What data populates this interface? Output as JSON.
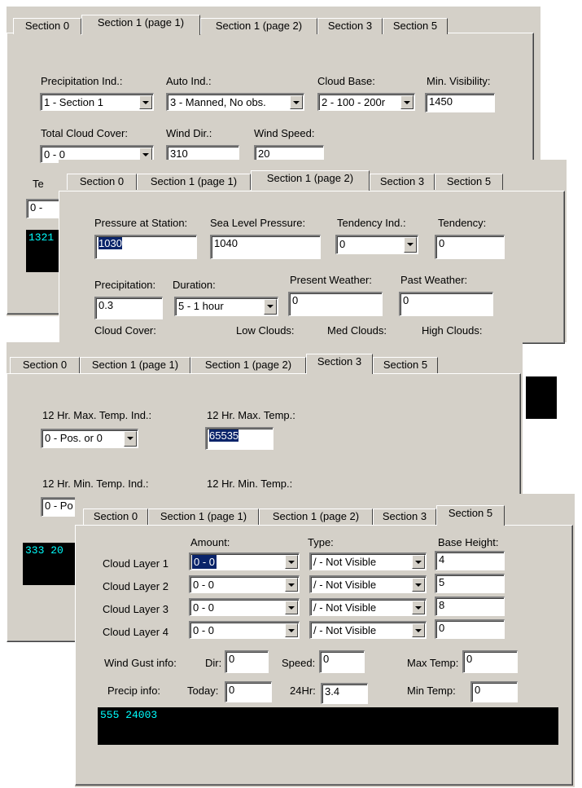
{
  "tabs": [
    "Section 0",
    "Section 1 (page 1)",
    "Section 1 (page 2)",
    "Section 3",
    "Section 5"
  ],
  "panel1": {
    "precip_ind_label": "Precipitation Ind.:",
    "precip_ind_value": "1 - Section 1",
    "auto_ind_label": "Auto Ind.:",
    "auto_ind_value": "3 - Manned, No obs.",
    "cloud_base_label": "Cloud Base:",
    "cloud_base_value": "2 - 100 - 200r",
    "min_vis_label": "Min. Visibility:",
    "min_vis_value": "1450",
    "total_cloud_label": "Total Cloud Cover:",
    "total_cloud_value": "0 - 0",
    "wind_dir_label": "Wind Dir.:",
    "wind_dir_value": "310",
    "wind_speed_label": "Wind Speed:",
    "wind_speed_value": "20",
    "partial_label": "Te",
    "partial_combo": "0 -",
    "terminal": "1321"
  },
  "panel2": {
    "pressure_station_label": "Pressure at Station:",
    "pressure_station_value": "1030",
    "sea_level_label": "Sea Level Pressure:",
    "sea_level_value": "1040",
    "tendency_ind_label": "Tendency Ind.:",
    "tendency_ind_value": "0",
    "tendency_label": "Tendency:",
    "tendency_value": "0",
    "precipitation_label": "Precipitation:",
    "precipitation_value": "0.3",
    "duration_label": "Duration:",
    "duration_value": "5 -  1 hour",
    "present_weather_label": "Present Weather:",
    "present_weather_value": "0",
    "past_weather_label": "Past Weather:",
    "past_weather_value": "0",
    "cloud_cover_label": "Cloud Cover:",
    "low_clouds_label": "Low Clouds:",
    "med_clouds_label": "Med Clouds:",
    "high_clouds_label": "High Clouds:"
  },
  "panel3": {
    "max_temp_ind_label": "12 Hr. Max. Temp. Ind.:",
    "max_temp_ind_value": "0 - Pos. or 0",
    "max_temp_label": "12 Hr. Max. Temp.:",
    "max_temp_value": "65535",
    "min_temp_ind_label": "12 Hr. Min. Temp. Ind.:",
    "min_temp_ind_value": "0 - Po",
    "min_temp_label": "12 Hr. Min. Temp.:",
    "terminal": "333 20"
  },
  "panel4": {
    "amount_label": "Amount:",
    "type_label": "Type:",
    "base_height_label": "Base Height:",
    "layers": [
      {
        "label": "Cloud Layer 1",
        "amount": "0 - 0",
        "type": "/ - Not Visible",
        "height": "4"
      },
      {
        "label": "Cloud Layer 2",
        "amount": "0 - 0",
        "type": "/ - Not Visible",
        "height": "5"
      },
      {
        "label": "Cloud Layer 3",
        "amount": "0 - 0",
        "type": "/ - Not Visible",
        "height": "8"
      },
      {
        "label": "Cloud Layer 4",
        "amount": "0 - 0",
        "type": "/ - Not Visible",
        "height": "0"
      }
    ],
    "wind_gust_label": "Wind Gust info:",
    "dir_label": "Dir:",
    "dir_value": "0",
    "speed_label": "Speed:",
    "speed_value": "0",
    "max_temp_label": "Max Temp:",
    "max_temp_value": "0",
    "precip_info_label": "Precip info:",
    "today_label": "Today:",
    "today_value": "0",
    "hr24_label": "24Hr:",
    "hr24_value": "3.4",
    "min_temp_label": "Min Temp:",
    "min_temp_value": "0",
    "terminal": "555 24003"
  }
}
